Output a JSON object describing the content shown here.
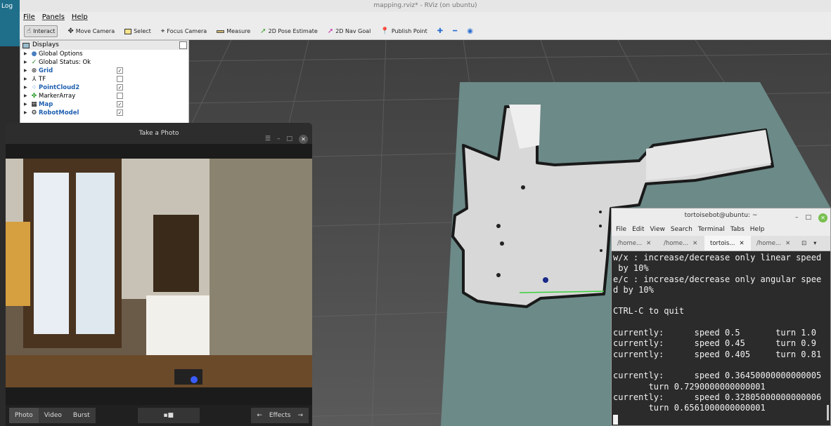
{
  "desktop": {
    "top_label": "Log"
  },
  "rviz": {
    "title": "mapping.rviz* - RViz (on ubuntu)",
    "menu": [
      "File",
      "Panels",
      "Help"
    ],
    "tools": [
      {
        "label": "Interact",
        "icon": "hand-icon"
      },
      {
        "label": "Move Camera",
        "icon": "move-icon"
      },
      {
        "label": "Select",
        "icon": "select-icon"
      },
      {
        "label": "Focus Camera",
        "icon": "focus-icon"
      },
      {
        "label": "Measure",
        "icon": "ruler-icon"
      },
      {
        "label": "2D Pose Estimate",
        "icon": "arrow-green-icon"
      },
      {
        "label": "2D Nav Goal",
        "icon": "arrow-pink-icon"
      },
      {
        "label": "Publish Point",
        "icon": "pin-icon"
      }
    ],
    "displays_title": "Displays",
    "displays": [
      {
        "label": "Global Options",
        "checked": null,
        "highlight": false
      },
      {
        "label": "Global Status: Ok",
        "checked": null,
        "highlight": false
      },
      {
        "label": "Grid",
        "checked": true,
        "highlight": true
      },
      {
        "label": "TF",
        "checked": false,
        "highlight": false
      },
      {
        "label": "PointCloud2",
        "checked": true,
        "highlight": true
      },
      {
        "label": "MarkerArray",
        "checked": false,
        "highlight": false
      },
      {
        "label": "Map",
        "checked": true,
        "highlight": true
      },
      {
        "label": "RobotModel",
        "checked": true,
        "highlight": true
      }
    ]
  },
  "camera": {
    "title": "Take a Photo",
    "modes": [
      "Photo",
      "Video",
      "Burst"
    ],
    "effects_label": "Effects"
  },
  "terminal": {
    "title": "tortoisebot@ubuntu: ~",
    "menu": [
      "File",
      "Edit",
      "View",
      "Search",
      "Terminal",
      "Tabs",
      "Help"
    ],
    "tabs": [
      "/home...",
      "/home...",
      "tortois...",
      "/home..."
    ],
    "active_tab": 2,
    "lines": [
      "w/x : increase/decrease only linear speed",
      " by 10%",
      "e/c : increase/decrease only angular spee",
      "d by 10%",
      "",
      "CTRL-C to quit",
      "",
      "currently:      speed 0.5       turn 1.0",
      "currently:      speed 0.45      turn 0.9",
      "currently:      speed 0.405     turn 0.81",
      "",
      "currently:      speed 0.36450000000000005",
      "       turn 0.7290000000000001",
      "currently:      speed 0.32805000000000006",
      "       turn 0.6561000000000001"
    ]
  }
}
